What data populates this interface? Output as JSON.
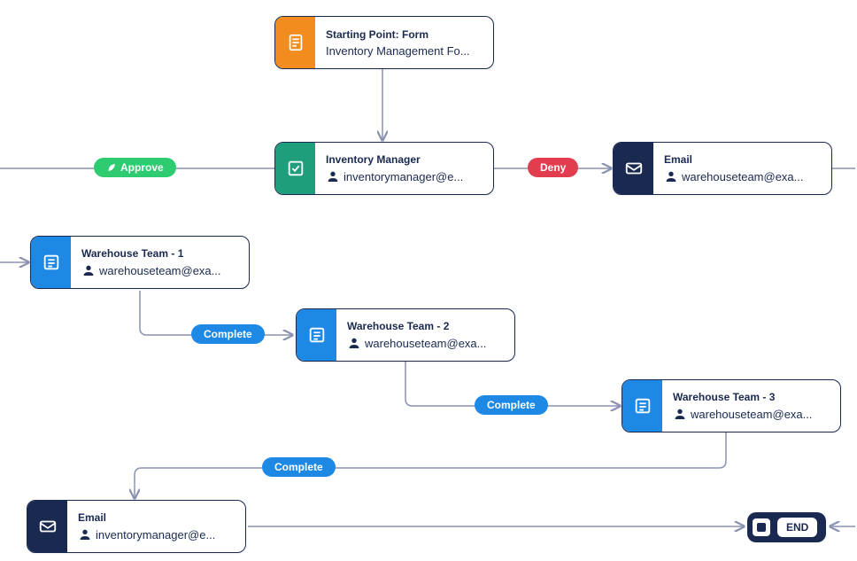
{
  "nodes": {
    "start": {
      "title": "Starting Point: Form",
      "subtitle": "Inventory Management Fo..."
    },
    "manager": {
      "title": "Inventory Manager",
      "subtitle": "inventorymanager@e..."
    },
    "emailDeny": {
      "title": "Email",
      "subtitle": "warehouseteam@exa..."
    },
    "wh1": {
      "title": "Warehouse Team - 1",
      "subtitle": "warehouseteam@exa..."
    },
    "wh2": {
      "title": "Warehouse Team - 2",
      "subtitle": "warehouseteam@exa..."
    },
    "wh3": {
      "title": "Warehouse Team - 3",
      "subtitle": "warehouseteam@exa..."
    },
    "emailEnd": {
      "title": "Email",
      "subtitle": "inventorymanager@e..."
    }
  },
  "pills": {
    "approve": "Approve",
    "deny": "Deny",
    "complete1": "Complete",
    "complete2": "Complete",
    "complete3": "Complete"
  },
  "end": {
    "label": "END"
  }
}
